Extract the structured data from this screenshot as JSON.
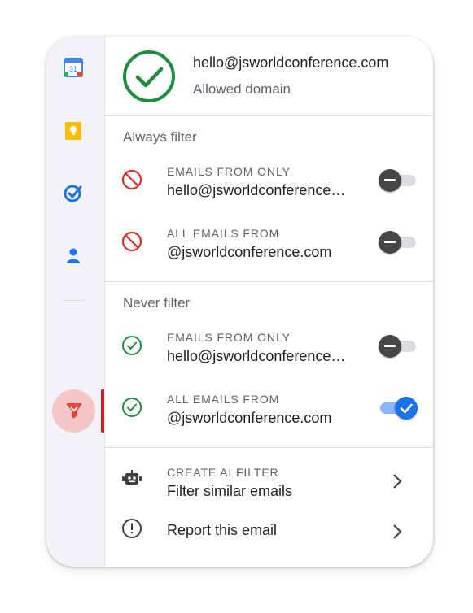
{
  "header": {
    "email": "hello@jsworldconference.com",
    "status": "Allowed domain"
  },
  "always_filter": {
    "title": "Always filter",
    "rows": [
      {
        "label": "EMAILS FROM ONLY",
        "value": "hello@jsworldconference…",
        "toggle": "off"
      },
      {
        "label": "ALL EMAILS FROM",
        "value": "@jsworldconference.com",
        "toggle": "off"
      }
    ]
  },
  "never_filter": {
    "title": "Never filter",
    "rows": [
      {
        "label": "EMAILS FROM ONLY",
        "value": "hello@jsworldconference…",
        "toggle": "off"
      },
      {
        "label": "ALL EMAILS FROM",
        "value": "@jsworldconference.com",
        "toggle": "on"
      }
    ]
  },
  "actions": {
    "ai_filter": {
      "label": "CREATE AI FILTER",
      "value": "Filter similar emails"
    },
    "report": {
      "value": "Report this email"
    }
  },
  "rail": {
    "icons": [
      "calendar-icon",
      "keep-icon",
      "tasks-icon",
      "contacts-icon",
      "extension-filter-icon"
    ],
    "calendar_day": "31"
  },
  "colors": {
    "allowed_green": "#1e8e3e",
    "block_red": "#d93025",
    "toggle_on": "#1a73e8",
    "toggle_off": "#444746"
  }
}
